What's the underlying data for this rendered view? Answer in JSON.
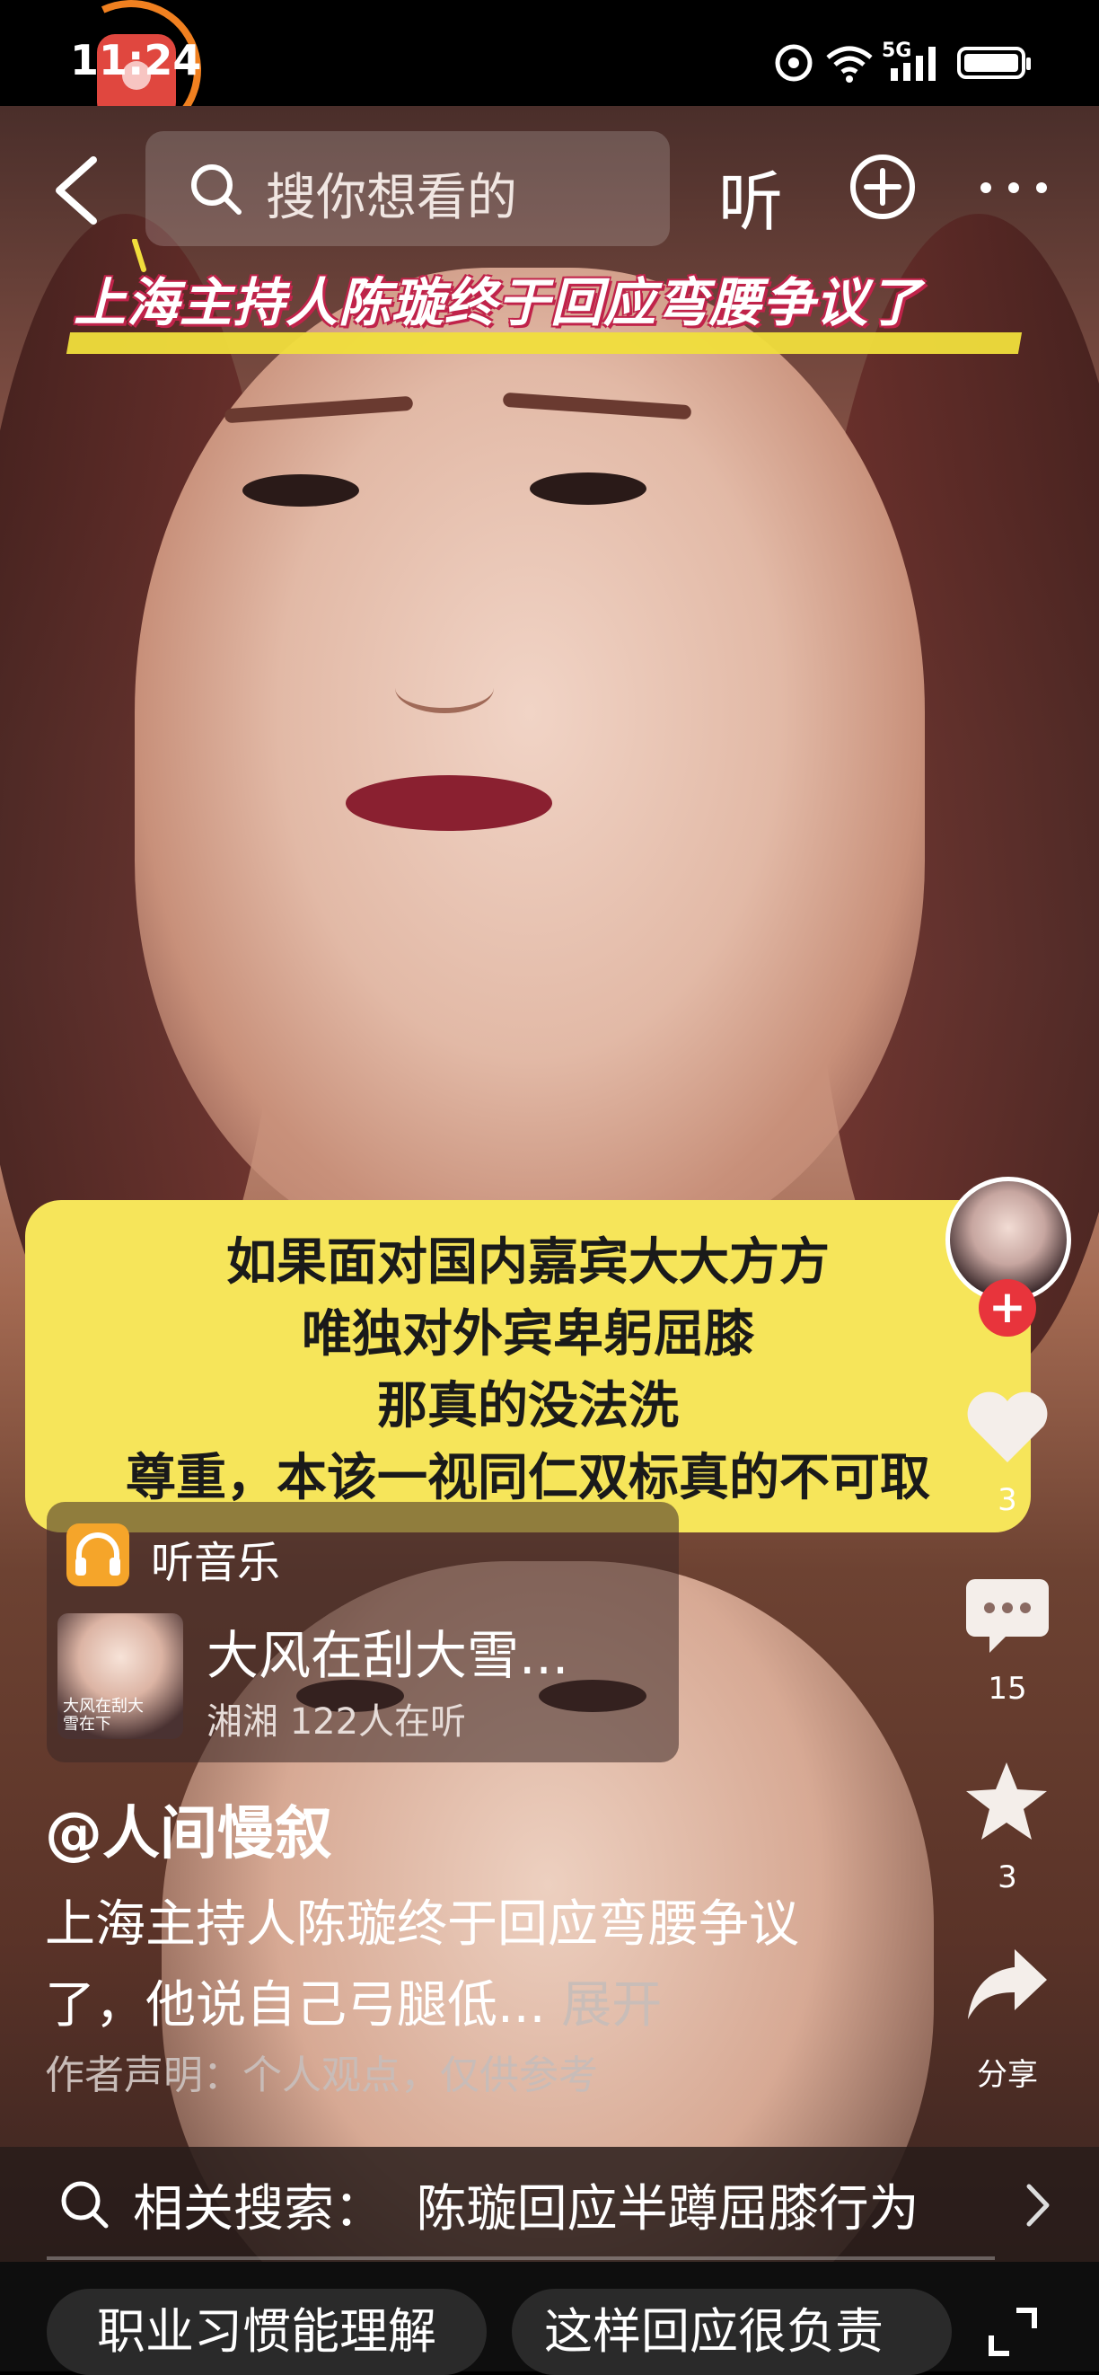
{
  "status_bar": {
    "time": "11:24",
    "network": "5G"
  },
  "top_nav": {
    "search_placeholder": "搜你想看的",
    "listen_label": "听"
  },
  "video": {
    "headline": "上海主持人陈璇终于回应弯腰争议了",
    "caption_lines": [
      "如果面对国内嘉宾大大方方",
      "唯独对外宾卑躬屈膝",
      "那真的没法洗",
      "尊重，本该一视同仁双标真的不可取"
    ]
  },
  "right_rail": {
    "like_count": "3",
    "comment_count": "15",
    "favorite_count": "3",
    "share_label": "分享"
  },
  "music": {
    "label": "听音乐",
    "album_text": "大风在刮大\n雪在下",
    "song_title": "大风在刮大雪...",
    "song_sub": "湘湘 122人在听"
  },
  "post": {
    "author": "@人间慢叙",
    "description": "上海主持人陈璇终于回应弯腰争议了，他说自己弓腿低...",
    "expand_label": "展开",
    "disclaimer": "作者声明：个人观点，仅供参考"
  },
  "related_search": {
    "text": "相关搜索：  陈璇回应半蹲屈膝行为"
  },
  "bottom_chips": [
    "职业习惯能理解",
    "这样回应很负责"
  ],
  "colors": {
    "caption_bg": "#f6e55a",
    "headline_stroke": "#c0234a",
    "follow": "#e8343c",
    "music_icon": "#f5a52a",
    "rec_ring": "#f08020"
  }
}
